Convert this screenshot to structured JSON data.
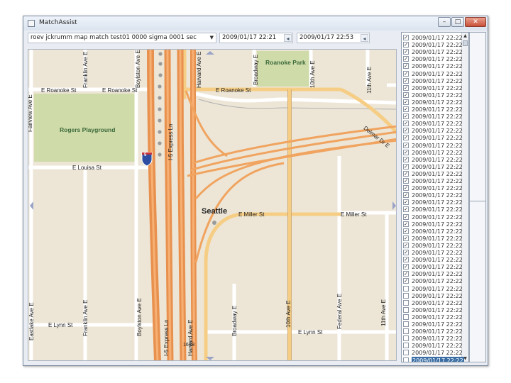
{
  "window": {
    "title": "MatchAssist",
    "minimize": "–",
    "maximize": "□",
    "close": "✕"
  },
  "toolbar": {
    "file_combo": "roev jckrumm map match test01 0000 sigma 0001 sec",
    "start_time": "2009/01/17 22:21",
    "end_time": "2009/01/17 22:53"
  },
  "map": {
    "streets": {
      "e_roanoke_st_1": "E Roanoke St",
      "e_roanoke_st_2": "E Roanoke St",
      "e_roanoke_st_3": "E Roanoke St",
      "e_louisa_st": "E Louisa St",
      "e_miller_st_1": "E Miller St",
      "e_miller_st_2": "E Miller St",
      "e_lynn_st_1": "E Lynn St",
      "e_lynn_st_2": "E Lynn St",
      "fairview_ave_e": "Fairview Ave E",
      "franklin_ave_e_top": "Franklin Ave E",
      "franklin_ave_e_bottom": "Franklin Ave E",
      "eastlake_ave_e": "Eastlake Ave E",
      "boylston_ave_e_top": "Boylston Ave E",
      "boylston_ave_e_bottom": "Boylston Ave E",
      "harvard_ave_e_top": "Harvard Ave E",
      "harvard_ave_e_bottom": "Harvard Ave E",
      "broadway_e_top": "Broadway E",
      "broadway_e_bottom": "Broadway E",
      "tenth_ave_e_top": "10th Ave E",
      "tenth_ave_e_bottom": "10th Ave E",
      "eleventh_ave_e_top": "11th Ave E",
      "eleventh_ave_e_bottom": "11th Ave E",
      "federal_ave_e": "Federal Ave E",
      "delmar_dr_e": "Delmar Dr E",
      "i5_express_1": "I-5 Express Ln",
      "i5_express_2": "I-5 Express Ln",
      "exit": "168B"
    },
    "parks": {
      "rogers": "Rogers Playground",
      "roanoke": "Roanoke Park"
    },
    "city": "Seattle",
    "shield": "5"
  },
  "list": {
    "items": [
      {
        "checked": true,
        "label": "2009/01/17 22:22"
      },
      {
        "checked": true,
        "label": "2009/01/17 22:22"
      },
      {
        "checked": true,
        "label": "2009/01/17 22:22"
      },
      {
        "checked": true,
        "label": "2009/01/17 22:22"
      },
      {
        "checked": true,
        "label": "2009/01/17 22:22"
      },
      {
        "checked": true,
        "label": "2009/01/17 22:22"
      },
      {
        "checked": true,
        "label": "2009/01/17 22:22"
      },
      {
        "checked": true,
        "label": "2009/01/17 22:22"
      },
      {
        "checked": true,
        "label": "2009/01/17 22:22"
      },
      {
        "checked": true,
        "label": "2009/01/17 22:22"
      },
      {
        "checked": true,
        "label": "2009/01/17 22:22"
      },
      {
        "checked": true,
        "label": "2009/01/17 22:22"
      },
      {
        "checked": true,
        "label": "2009/01/17 22:22"
      },
      {
        "checked": true,
        "label": "2009/01/17 22:22"
      },
      {
        "checked": true,
        "label": "2009/01/17 22:22"
      },
      {
        "checked": true,
        "label": "2009/01/17 22:22"
      },
      {
        "checked": true,
        "label": "2009/01/17 22:22"
      },
      {
        "checked": true,
        "label": "2009/01/17 22:22"
      },
      {
        "checked": true,
        "label": "2009/01/17 22:22"
      },
      {
        "checked": true,
        "label": "2009/01/17 22:22"
      },
      {
        "checked": true,
        "label": "2009/01/17 22:22"
      },
      {
        "checked": true,
        "label": "2009/01/17 22:22"
      },
      {
        "checked": true,
        "label": "2009/01/17 22:22"
      },
      {
        "checked": true,
        "label": "2009/01/17 22:22"
      },
      {
        "checked": true,
        "label": "2009/01/17 22:22"
      },
      {
        "checked": true,
        "label": "2009/01/17 22:22"
      },
      {
        "checked": true,
        "label": "2009/01/17 22:22"
      },
      {
        "checked": true,
        "label": "2009/01/17 22:22"
      },
      {
        "checked": true,
        "label": "2009/01/17 22:22"
      },
      {
        "checked": true,
        "label": "2009/01/17 22:22"
      },
      {
        "checked": true,
        "label": "2009/01/17 22:22"
      },
      {
        "checked": true,
        "label": "2009/01/17 22:22"
      },
      {
        "checked": true,
        "label": "2009/01/17 22:22"
      },
      {
        "checked": true,
        "label": "2009/01/17 22:22"
      },
      {
        "checked": true,
        "label": "2009/01/17 22:22"
      },
      {
        "checked": false,
        "label": "2009/01/17 22:22"
      },
      {
        "checked": false,
        "label": "2009/01/17 22:22"
      },
      {
        "checked": false,
        "label": "2009/01/17 22:22"
      },
      {
        "checked": false,
        "label": "2009/01/17 22:22"
      },
      {
        "checked": false,
        "label": "2009/01/17 22:22"
      },
      {
        "checked": false,
        "label": "2009/01/17 22:22"
      },
      {
        "checked": false,
        "label": "2009/01/17 22:22"
      },
      {
        "checked": false,
        "label": "2009/01/17 22:22"
      },
      {
        "checked": false,
        "label": "2009/01/17 22:22"
      },
      {
        "checked": false,
        "label": "2009/01/17 22:22"
      },
      {
        "checked": false,
        "label": "2009/01/17 22:22"
      }
    ],
    "selected_index": 45,
    "check_mark": "✓",
    "scroll_up": "▲",
    "scroll_down": "▼"
  },
  "colors": {
    "freeway": "#e8914f",
    "arterial": "#f6cd84",
    "park": "#cfdba8",
    "street": "#ffffff",
    "background": "#ede6d7"
  }
}
